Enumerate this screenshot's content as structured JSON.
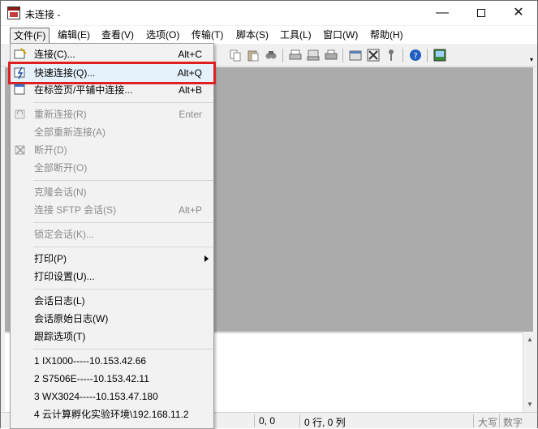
{
  "window": {
    "title": "未连接 -",
    "minimize_glyph": "—",
    "close_glyph": "✕"
  },
  "menubar": {
    "items": [
      {
        "label": "文件(F)"
      },
      {
        "label": "编辑(E)"
      },
      {
        "label": "查看(V)"
      },
      {
        "label": "选项(O)"
      },
      {
        "label": "传输(T)"
      },
      {
        "label": "脚本(S)"
      },
      {
        "label": "工具(L)"
      },
      {
        "label": "窗口(W)"
      },
      {
        "label": "帮助(H)"
      }
    ]
  },
  "file_menu": {
    "items": [
      {
        "label": "连接(C)...",
        "accel": "Alt+C"
      },
      {
        "label": "快速连接(Q)...",
        "accel": "Alt+Q"
      },
      {
        "label": "在标签页/平铺中连接...",
        "accel": "Alt+B"
      },
      {
        "label": "重新连接(R)",
        "accel": "Enter"
      },
      {
        "label": "全部重新连接(A)",
        "accel": ""
      },
      {
        "label": "断开(D)",
        "accel": ""
      },
      {
        "label": "全部断开(O)",
        "accel": ""
      },
      {
        "label": "克隆会话(N)",
        "accel": ""
      },
      {
        "label": "连接 SFTP 会话(S)",
        "accel": "Alt+P"
      },
      {
        "label": "锁定会话(K)...",
        "accel": ""
      },
      {
        "label": "打印(P)",
        "accel": ""
      },
      {
        "label": "打印设置(U)...",
        "accel": ""
      },
      {
        "label": "会话日志(L)",
        "accel": ""
      },
      {
        "label": "会话原始日志(W)",
        "accel": ""
      },
      {
        "label": "跟踪选项(T)",
        "accel": ""
      },
      {
        "label": "1 IX1000-----10.153.42.66",
        "accel": ""
      },
      {
        "label": "2 S7506E-----10.153.42.11",
        "accel": ""
      },
      {
        "label": "3 WX3024-----10.153.47.180",
        "accel": ""
      },
      {
        "label": "4 云计算孵化实验环境\\192.168.11.2",
        "accel": ""
      }
    ]
  },
  "statusbar": {
    "cursor": "0, 0",
    "rowcol": "0 行, 0 列",
    "caps": "大写",
    "num": "数字"
  },
  "colors": {
    "highlight_border": "#e02020",
    "workspace": "#ababab"
  }
}
